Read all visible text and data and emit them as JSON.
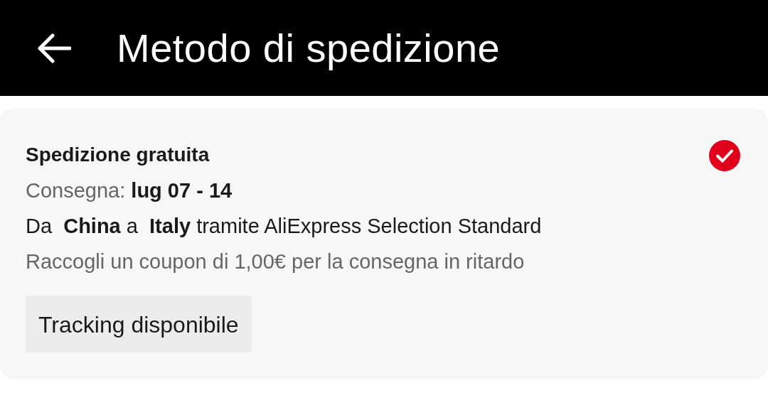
{
  "header": {
    "title": "Metodo di spedizione"
  },
  "shipping_options": [
    {
      "name": "Spedizione gratuita",
      "selected": true,
      "delivery": "Consegna: **lug 07 - 14**",
      "route": "Da  **China** a  **Italy** tramite AliExpress Selection Standard",
      "coupon": "Raccogli un coupon di 1,00€ per la consegna in ritardo",
      "tags": [
        "Tracking disponibile"
      ]
    }
  ]
}
